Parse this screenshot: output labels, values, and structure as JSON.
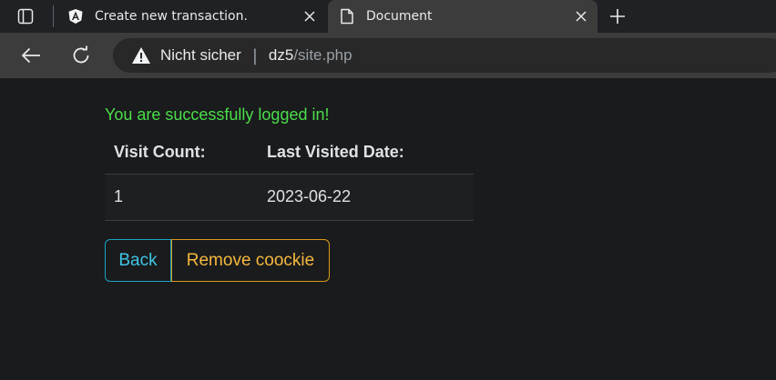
{
  "tabs": [
    {
      "title": "Create new transaction.",
      "icon": "angular-icon",
      "active": false
    },
    {
      "title": "Document",
      "icon": "document-icon",
      "active": true
    }
  ],
  "address_bar": {
    "security_label": "Nicht sicher",
    "host": "dz5",
    "path": "/site.php"
  },
  "page": {
    "success_message": "You are successfully logged in!",
    "table": {
      "headers": [
        "Visit Count:",
        "Last Visited Date:"
      ],
      "rows": [
        [
          "1",
          "2023-06-22"
        ]
      ]
    },
    "buttons": {
      "back_label": "Back",
      "remove_label": "Remove coockie"
    }
  },
  "colors": {
    "success": "#4ade4a",
    "back_button": "#3ec5e6",
    "remove_button": "#f5b83d",
    "background": "#1a1b1c"
  }
}
